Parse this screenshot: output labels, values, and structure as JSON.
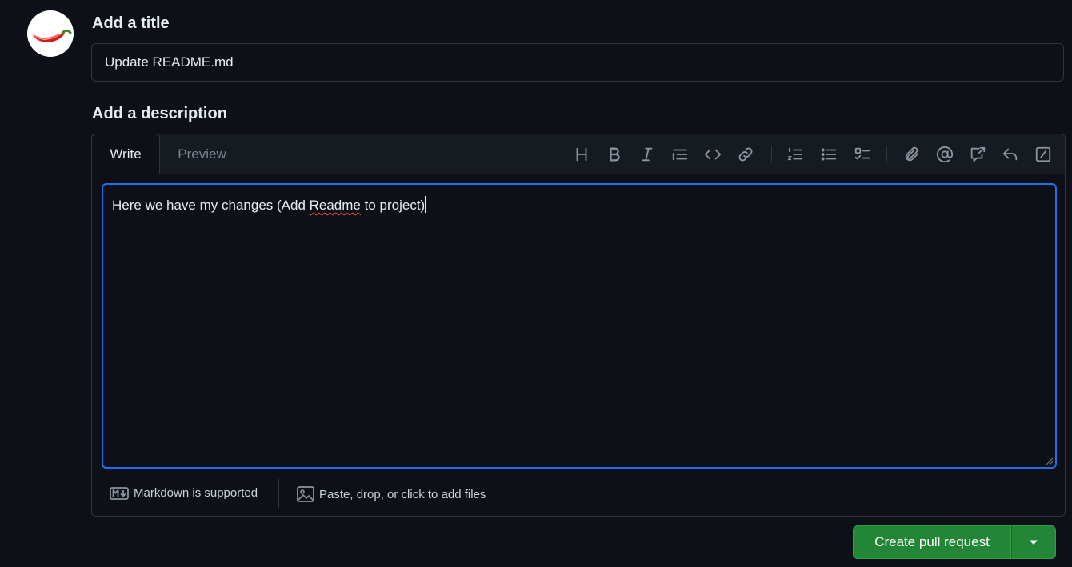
{
  "avatar": {
    "alt": "user avatar",
    "icon": "chili-pepper-icon"
  },
  "title_section": {
    "label": "Add a title",
    "value": "Update README.md"
  },
  "description_section": {
    "label": "Add a description",
    "tabs": [
      {
        "label": "Write",
        "active": true
      },
      {
        "label": "Preview",
        "active": false
      }
    ],
    "toolbar": [
      "heading-icon",
      "bold-icon",
      "italic-icon",
      "quote-icon",
      "code-icon",
      "link-icon",
      "numbered-list-icon",
      "unordered-list-icon",
      "task-list-icon",
      "attach-icon",
      "mention-icon",
      "cross-reference-icon",
      "reply-icon",
      "slash-command-icon"
    ],
    "body": {
      "before": "Here we have my changes (Add ",
      "misspelled": "Readme",
      "after": " to project)"
    },
    "footer": {
      "markdown": "Markdown is supported",
      "files": "Paste, drop, or click to add files"
    }
  },
  "actions": {
    "create_label": "Create pull request"
  },
  "colors": {
    "background": "#0d1117",
    "border": "#30363d",
    "focus": "#1f6feb",
    "primary_button": "#238636"
  }
}
